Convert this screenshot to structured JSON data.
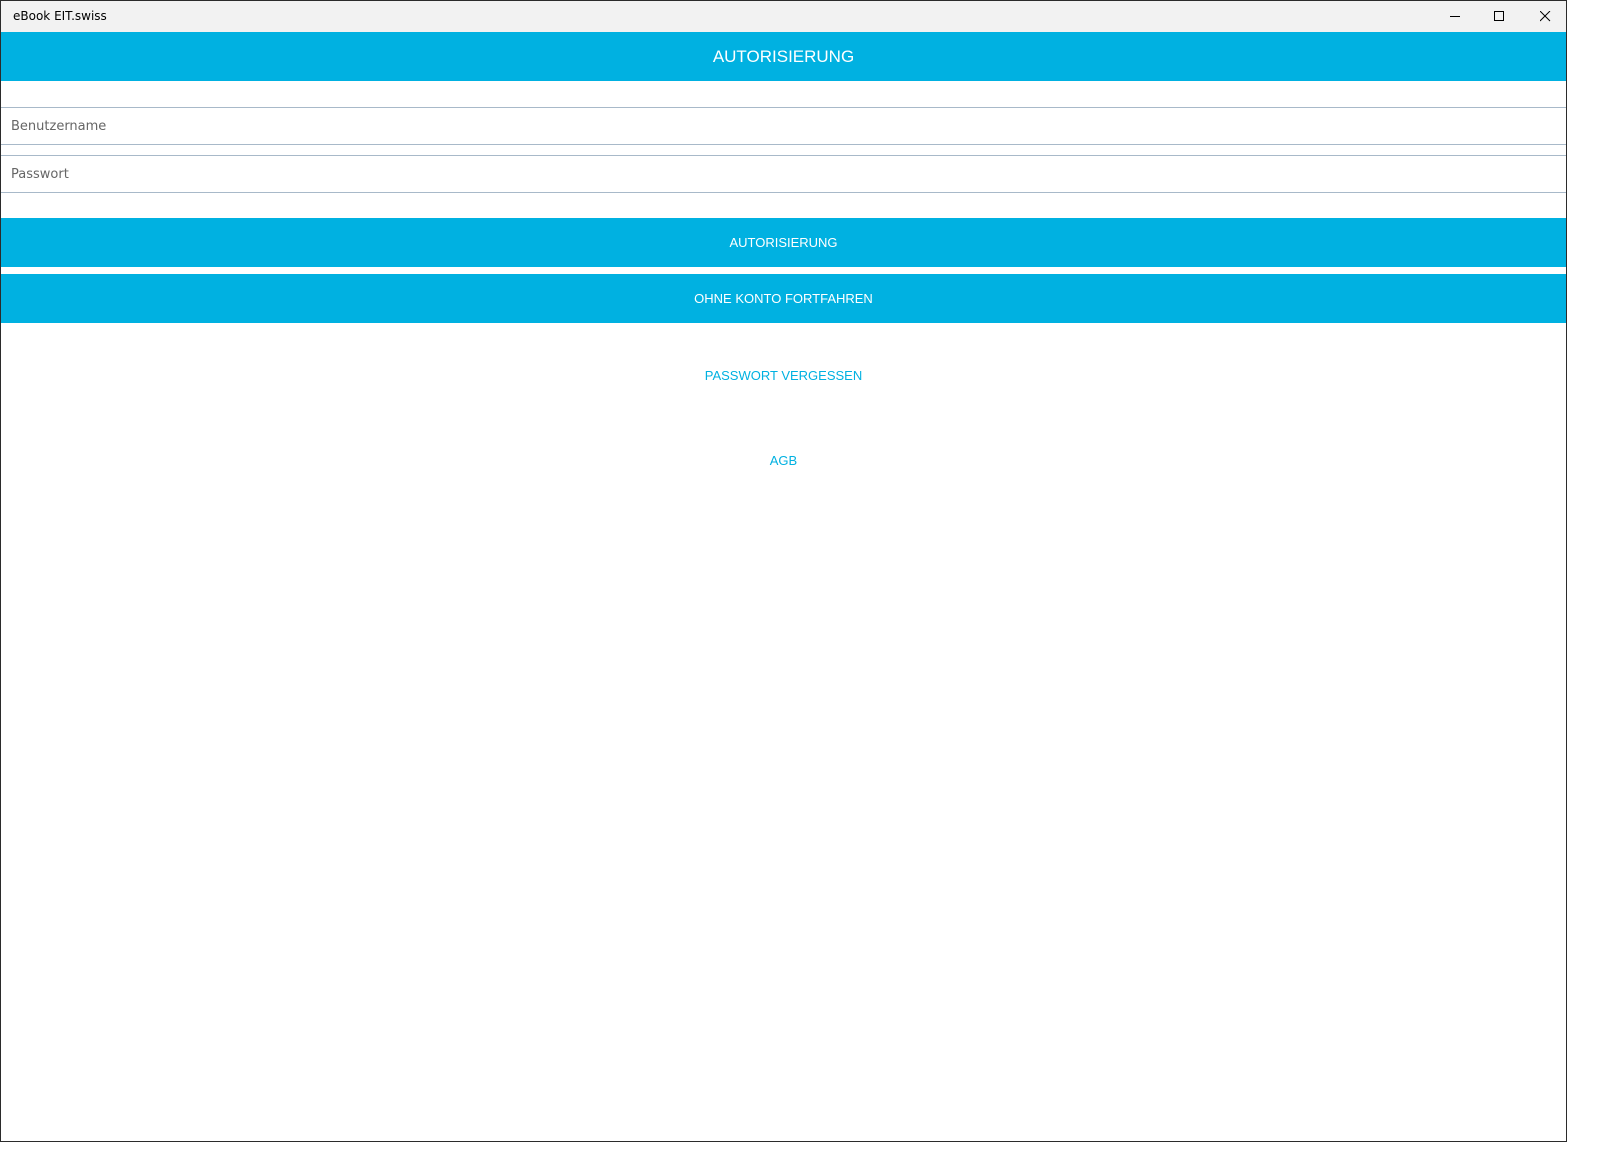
{
  "window": {
    "title": "eBook EIT.swiss"
  },
  "appbar": {
    "title": "AUTORISIERUNG"
  },
  "form": {
    "username_placeholder": "Benutzername",
    "username_value": "",
    "password_placeholder": "Passwort",
    "password_value": "",
    "authorize_label": "AUTORISIERUNG",
    "continue_without_account_label": "OHNE KONTO FORTFAHREN",
    "forgot_password_label": "PASSWORT VERGESSEN",
    "terms_label": "AGB"
  },
  "colors": {
    "accent": "#00b1e1",
    "titlebar": "#f2f2f2",
    "field_border": "#a8b9c9"
  },
  "icons": [
    "minimize-icon",
    "maximize-icon",
    "close-icon"
  ]
}
